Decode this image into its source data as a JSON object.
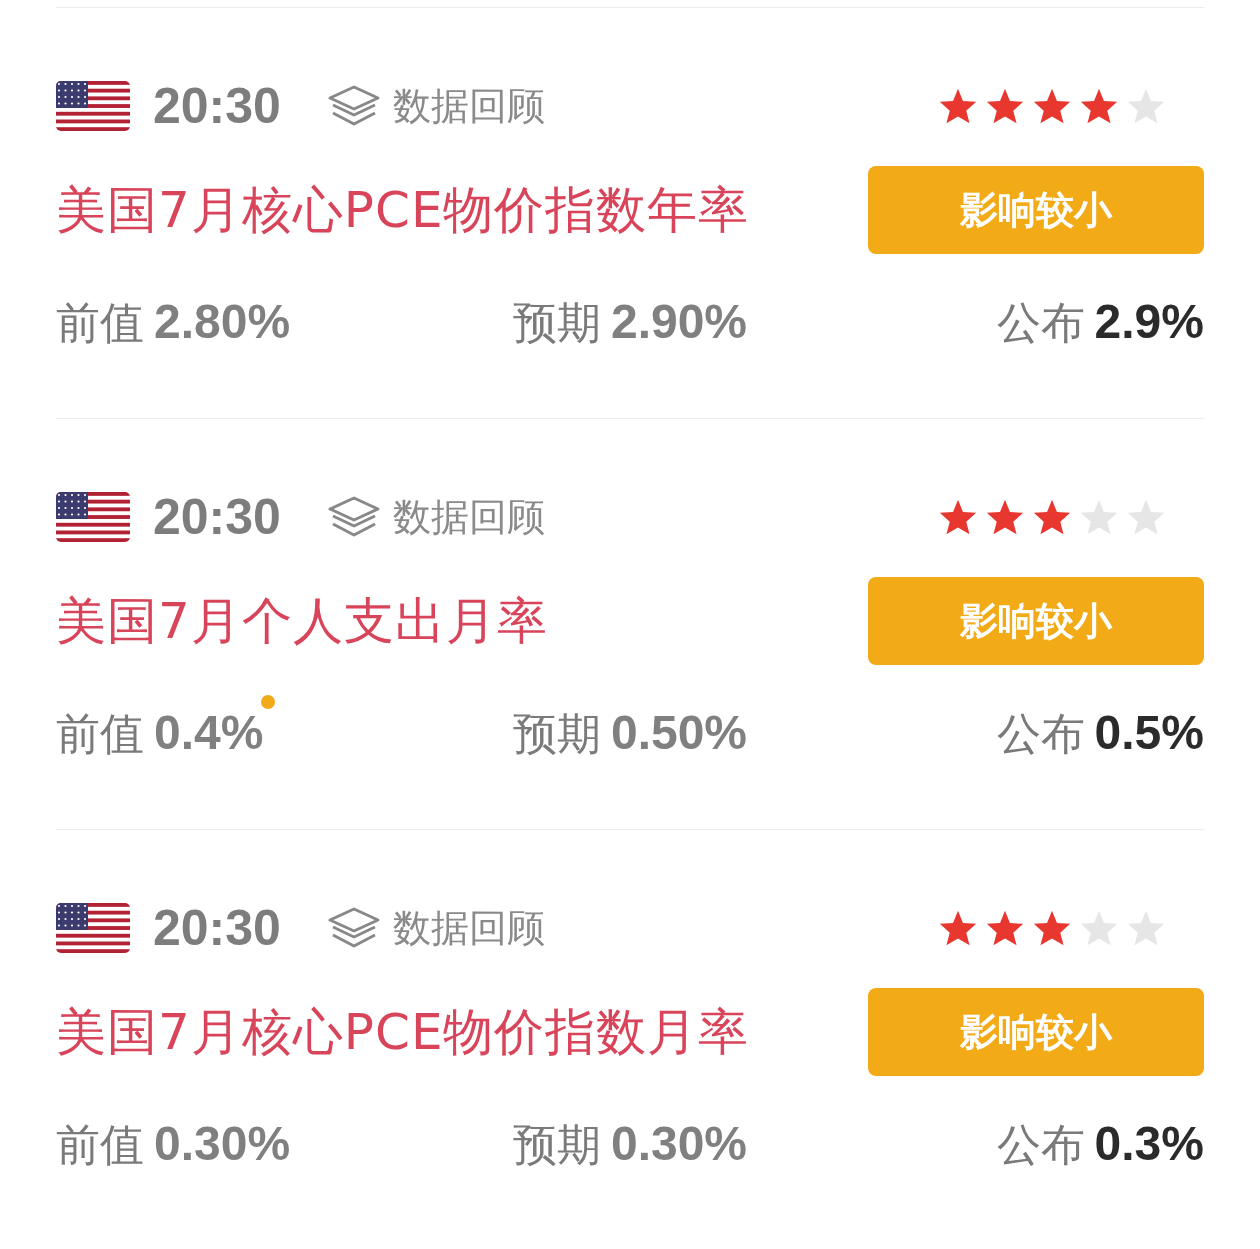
{
  "events": [
    {
      "time": "20:30",
      "review_label": "数据回顾",
      "stars": 4,
      "title": "美国7月核心PCE物价指数年率",
      "impact": "影响较小",
      "previous": {
        "label": "前值",
        "value": "2.80%",
        "revised": false
      },
      "forecast": {
        "label": "预期",
        "value": "2.90%"
      },
      "actual": {
        "label": "公布",
        "value": "2.9%"
      }
    },
    {
      "time": "20:30",
      "review_label": "数据回顾",
      "stars": 3,
      "title": "美国7月个人支出月率",
      "impact": "影响较小",
      "previous": {
        "label": "前值",
        "value": "0.4%",
        "revised": true
      },
      "forecast": {
        "label": "预期",
        "value": "0.50%"
      },
      "actual": {
        "label": "公布",
        "value": "0.5%"
      }
    },
    {
      "time": "20:30",
      "review_label": "数据回顾",
      "stars": 3,
      "title": "美国7月核心PCE物价指数月率",
      "impact": "影响较小",
      "previous": {
        "label": "前值",
        "value": "0.30%",
        "revised": false
      },
      "forecast": {
        "label": "预期",
        "value": "0.30%"
      },
      "actual": {
        "label": "公布",
        "value": "0.3%"
      }
    }
  ]
}
